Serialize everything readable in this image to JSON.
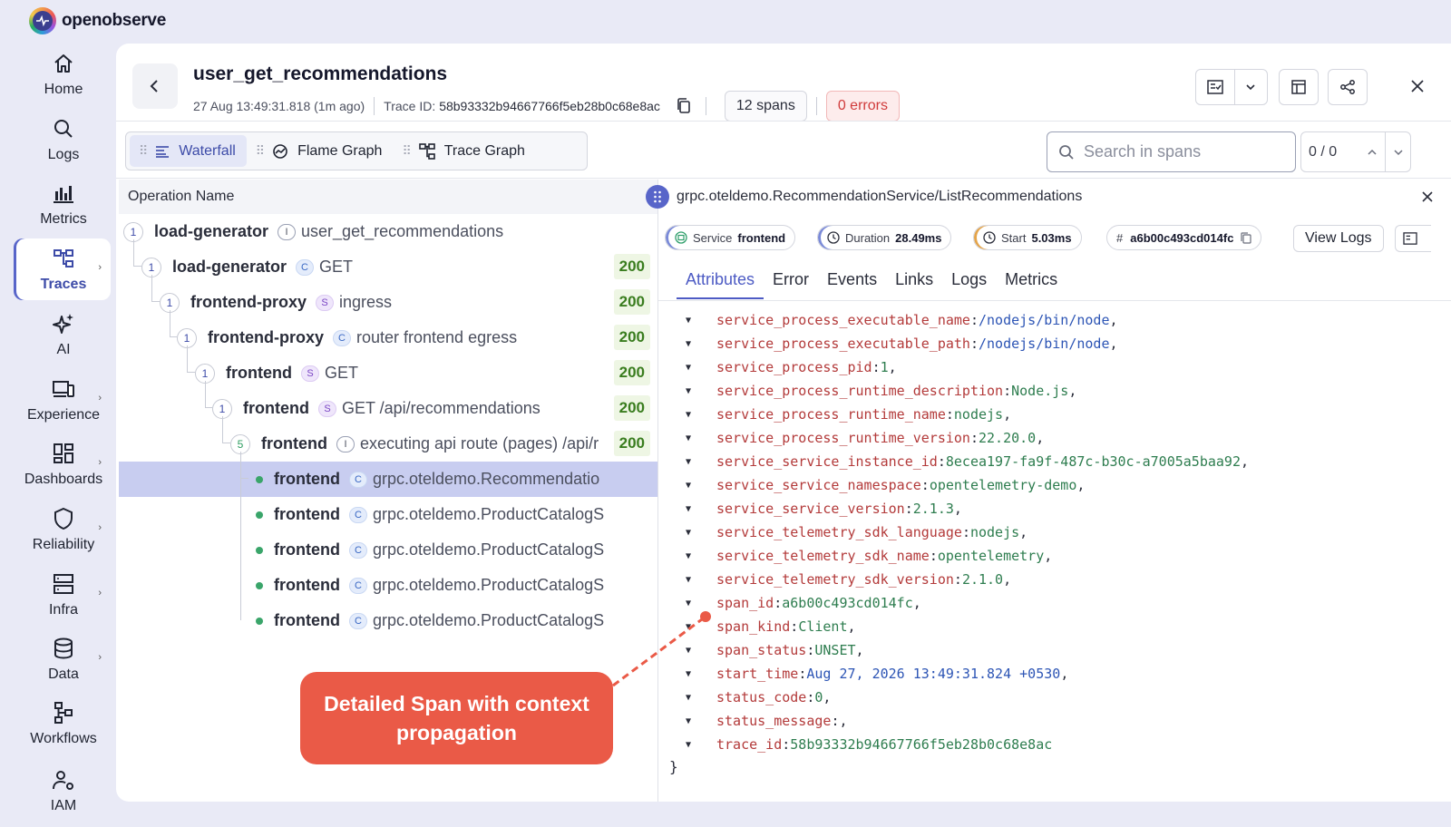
{
  "brand": {
    "name": "openobserve"
  },
  "nav": [
    {
      "label": "Home",
      "icon": "home-icon"
    },
    {
      "label": "Logs",
      "icon": "search-icon"
    },
    {
      "label": "Metrics",
      "icon": "bar-chart-icon"
    },
    {
      "label": "Traces",
      "icon": "traces-icon",
      "active": true
    },
    {
      "label": "AI",
      "icon": "sparkle-icon"
    },
    {
      "label": "Experience",
      "icon": "devices-icon"
    },
    {
      "label": "Dashboards",
      "icon": "dashboard-icon"
    },
    {
      "label": "Reliability",
      "icon": "shield-icon"
    },
    {
      "label": "Infra",
      "icon": "server-icon"
    },
    {
      "label": "Data",
      "icon": "database-icon"
    },
    {
      "label": "Workflows",
      "icon": "workflow-icon"
    },
    {
      "label": "IAM",
      "icon": "users-gear-icon"
    }
  ],
  "trace": {
    "title": "user_get_recommendations",
    "timestamp": "27 Aug 13:49:31.818 (1m ago)",
    "trace_id_label": "Trace ID:",
    "trace_id": "58b93332b94667766f5eb28b0c68e8ac",
    "spans": "12 spans",
    "errors": "0 errors"
  },
  "view_tabs": [
    "Waterfall",
    "Flame Graph",
    "Trace Graph"
  ],
  "search": {
    "placeholder": "Search in spans",
    "counter": "0 / 0"
  },
  "tree": {
    "header": "Operation Name",
    "rows": [
      {
        "count": "1",
        "service": "load-generator",
        "kind": "I",
        "op": "user_get_recommendations",
        "status": ""
      },
      {
        "count": "1",
        "service": "load-generator",
        "kind": "C",
        "op": "GET",
        "status": "200"
      },
      {
        "count": "1",
        "service": "frontend-proxy",
        "kind": "S",
        "op": "ingress",
        "status": "200"
      },
      {
        "count": "1",
        "service": "frontend-proxy",
        "kind": "C",
        "op": "router frontend egress",
        "status": "200"
      },
      {
        "count": "1",
        "service": "frontend",
        "kind": "S",
        "op": "GET",
        "status": "200"
      },
      {
        "count": "1",
        "service": "frontend",
        "kind": "S",
        "op": "GET /api/recommendations",
        "status": "200"
      },
      {
        "count": "5",
        "service": "frontend",
        "kind": "I",
        "op": "executing api route (pages) /api/r",
        "status": "200"
      },
      {
        "count": "",
        "service": "frontend",
        "kind": "C",
        "op": "grpc.oteldemo.Recommendatio",
        "status": ""
      },
      {
        "count": "",
        "service": "frontend",
        "kind": "C",
        "op": "grpc.oteldemo.ProductCatalogS",
        "status": ""
      },
      {
        "count": "",
        "service": "frontend",
        "kind": "C",
        "op": "grpc.oteldemo.ProductCatalogS",
        "status": ""
      },
      {
        "count": "",
        "service": "frontend",
        "kind": "C",
        "op": "grpc.oteldemo.ProductCatalogS",
        "status": ""
      },
      {
        "count": "",
        "service": "frontend",
        "kind": "C",
        "op": "grpc.oteldemo.ProductCatalogS",
        "status": ""
      }
    ]
  },
  "span": {
    "name": "grpc.oteldemo.RecommendationService/ListRecommendations",
    "service_label": "Service",
    "service": "frontend",
    "duration_label": "Duration",
    "duration": "28.49ms",
    "start_label": "Start",
    "start": "5.03ms",
    "id_label": "#",
    "span_id": "a6b00c493cd014fc",
    "view_logs": "View Logs",
    "tabs": [
      "Attributes",
      "Error",
      "Events",
      "Links",
      "Logs",
      "Metrics"
    ]
  },
  "attributes": [
    {
      "key": "service_process_executable_name",
      "value": "/nodejs/bin/node",
      "type": "path"
    },
    {
      "key": "service_process_executable_path",
      "value": "/nodejs/bin/node",
      "type": "path"
    },
    {
      "key": "service_process_pid",
      "value": "1",
      "type": "num"
    },
    {
      "key": "service_process_runtime_description",
      "value": "Node.js",
      "type": "str"
    },
    {
      "key": "service_process_runtime_name",
      "value": "nodejs",
      "type": "str"
    },
    {
      "key": "service_process_runtime_version",
      "value": "22.20.0",
      "type": "str"
    },
    {
      "key": "service_service_instance_id",
      "value": "8ecea197-fa9f-487c-b30c-a7005a5baa92",
      "type": "str"
    },
    {
      "key": "service_service_namespace",
      "value": "opentelemetry-demo",
      "type": "str"
    },
    {
      "key": "service_service_version",
      "value": "2.1.3",
      "type": "str"
    },
    {
      "key": "service_telemetry_sdk_language",
      "value": "nodejs",
      "type": "str"
    },
    {
      "key": "service_telemetry_sdk_name",
      "value": "opentelemetry",
      "type": "str"
    },
    {
      "key": "service_telemetry_sdk_version",
      "value": "2.1.0",
      "type": "str"
    },
    {
      "key": "span_id",
      "value": "a6b00c493cd014fc",
      "type": "str"
    },
    {
      "key": "span_kind",
      "value": "Client",
      "type": "str"
    },
    {
      "key": "span_status",
      "value": "UNSET",
      "type": "str"
    },
    {
      "key": "start_time",
      "value": "Aug 27, 2026 13:49:31.824 +0530",
      "type": "date"
    },
    {
      "key": "status_code",
      "value": "0",
      "type": "num"
    },
    {
      "key": "status_message",
      "value": " ",
      "type": "str"
    },
    {
      "key": "trace_id",
      "value": "58b93332b94667766f5eb28b0c68e8ac",
      "type": "str",
      "last": true
    }
  ],
  "closing_brace": "}",
  "callout": {
    "text": "Detailed Span with context propagation"
  },
  "colors": {
    "accent": "#4d5bc4",
    "callout": "#ea5a47",
    "selected_row": "#c8cdf0",
    "status_ok": "#3a7d1f"
  }
}
